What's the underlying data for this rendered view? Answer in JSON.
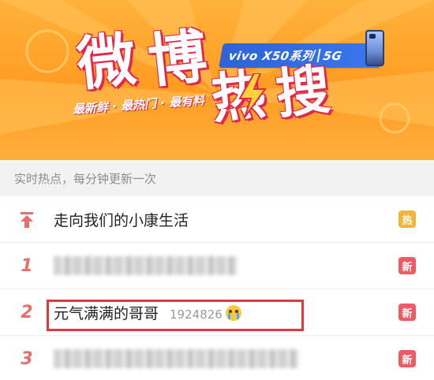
{
  "banner": {
    "title_wei": [
      "微",
      "博"
    ],
    "title_re": [
      "热",
      "搜"
    ],
    "slogan": "最新鲜 · 最热门 · 最有料",
    "sponsor": {
      "brand": "vivo X50系列",
      "network": "5G"
    }
  },
  "subheader": {
    "text": "实时热点，每分钟更新一次"
  },
  "list": {
    "pinned": {
      "title": "走向我们的小康生活",
      "badge": "热"
    },
    "items": [
      {
        "rank": "1",
        "title": "",
        "badge": "新",
        "blurred": true
      },
      {
        "rank": "2",
        "title": "元气满满的哥哥",
        "count": "1924826",
        "badge": "新",
        "blurred": false,
        "highlighted": true
      },
      {
        "rank": "3",
        "title": "",
        "badge": "新",
        "blurred": true
      }
    ]
  },
  "colors": {
    "banner": "#ffa22c",
    "rank": "#e2716c",
    "badge_hot": "#f4b43a",
    "badge_new": "#ef5b65",
    "highlight": "#e0383f"
  }
}
